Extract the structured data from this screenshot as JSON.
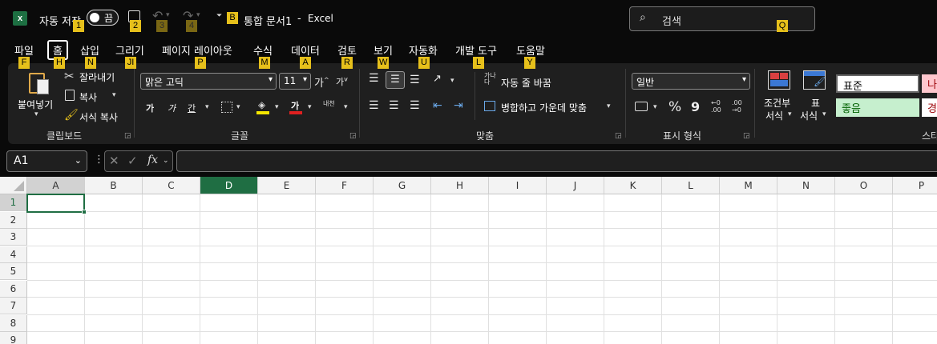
{
  "titlebar": {
    "app_icon": "excel-logo-icon",
    "autosave_label": "자동 저장",
    "autosave_toggle": "끔",
    "title": "통합 문서1",
    "separator": "-",
    "app_name": "Excel",
    "search_placeholder": "검색"
  },
  "keytips": {
    "autosave": "1",
    "save": "2",
    "undo": "3",
    "redo": "4",
    "customize": "B",
    "search": "Q",
    "file": "F",
    "home": "H",
    "insert": "N",
    "draw": "JI",
    "layout": "P",
    "formulas": "M",
    "data": "A",
    "review": "R",
    "view": "W",
    "automate": "U",
    "developer": "L",
    "help": "Y"
  },
  "tabs": [
    "파일",
    "홈",
    "삽입",
    "그리기",
    "페이지 레이아웃",
    "수식",
    "데이터",
    "검토",
    "보기",
    "자동화",
    "개발 도구",
    "도움말"
  ],
  "ribbon": {
    "clipboard": {
      "paste": "붙여넣기",
      "cut": "잘라내기",
      "copy": "복사",
      "format_painter": "서식 복사",
      "group_label": "클립보드"
    },
    "font": {
      "font_name": "맑은 고딕",
      "font_size": "11",
      "grow": "가",
      "shrink": "가",
      "bold": "가",
      "italic": "가",
      "underline": "간",
      "font_color_glyph": "가",
      "phonetic": "내천",
      "group_label": "글꼴",
      "fill_color": "#f5e600",
      "font_color": "#e02020"
    },
    "alignment": {
      "wrap_text": "자동 줄 바꿈",
      "merge_center": "병합하고 가운데 맞춤",
      "group_label": "맞춤"
    },
    "number": {
      "format": "일반",
      "percent": "%",
      "comma": "9",
      "group_label": "표시 형식"
    },
    "styles": {
      "conditional_line1": "조건부",
      "conditional_line2": "서식",
      "table_line1": "표",
      "table_line2": "서식",
      "normal": "표준",
      "bad": "나",
      "good": "좋음",
      "neutral": "경",
      "group_label": "스타"
    }
  },
  "formula_bar": {
    "name_box": "A1",
    "fx": "fx"
  },
  "grid": {
    "columns": [
      "A",
      "B",
      "C",
      "D",
      "E",
      "F",
      "G",
      "H",
      "I",
      "J",
      "K",
      "L",
      "M",
      "N",
      "O",
      "P"
    ],
    "rows": [
      "1",
      "2",
      "3",
      "4",
      "5",
      "6",
      "7",
      "8",
      "9"
    ],
    "selected_cell": "A1"
  }
}
